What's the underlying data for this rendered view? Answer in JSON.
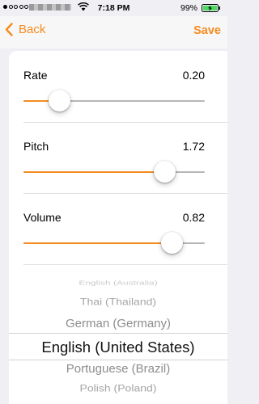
{
  "status_bar": {
    "time": "7:18 PM",
    "battery": "99%"
  },
  "nav": {
    "back_label": "Back",
    "save_label": "Save"
  },
  "sliders": [
    {
      "label": "Rate",
      "value": "0.20",
      "fraction": 0.2
    },
    {
      "label": "Pitch",
      "value": "1.72",
      "fraction": 0.78
    },
    {
      "label": "Volume",
      "value": "0.82",
      "fraction": 0.82
    }
  ],
  "voice_picker": {
    "items": [
      "English (Australia)",
      "Thai (Thailand)",
      "German (Germany)",
      "English (United States)",
      "Portuguese (Brazil)",
      "Polish (Poland)"
    ],
    "selected": "English (United States)"
  },
  "colors": {
    "accent": "#f58b1f"
  }
}
